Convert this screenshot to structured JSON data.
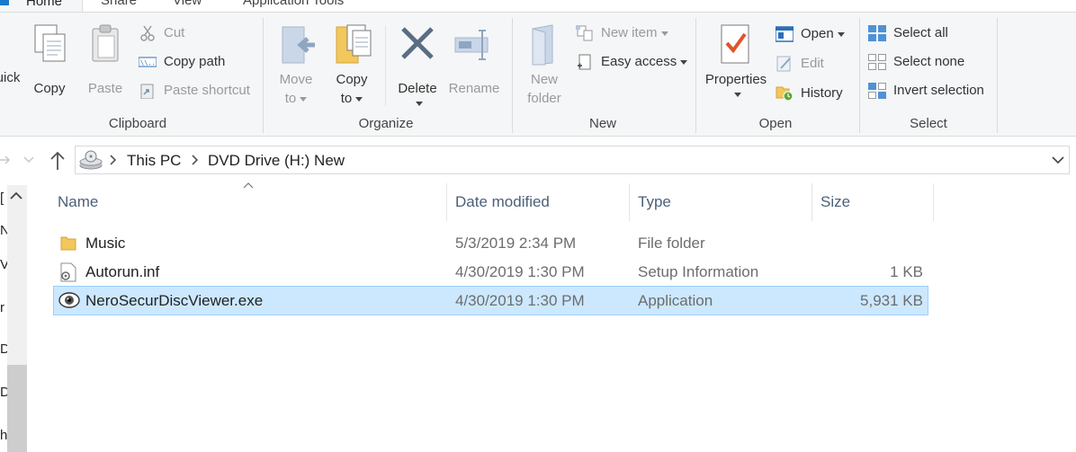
{
  "tabs": {
    "home": "Home",
    "share": "Share",
    "view": "View",
    "apptools": "Application Tools"
  },
  "clipboard": {
    "quick_access_label": "uick",
    "copy": "Copy",
    "paste": "Paste",
    "cut": "Cut",
    "copy_path": "Copy path",
    "paste_shortcut": "Paste shortcut",
    "group": "Clipboard"
  },
  "organize": {
    "move_to_1": "Move",
    "move_to_2": "to",
    "copy_to_1": "Copy",
    "copy_to_2": "to",
    "delete": "Delete",
    "rename": "Rename",
    "group": "Organize"
  },
  "new": {
    "new_folder_1": "New",
    "new_folder_2": "folder",
    "new_item": "New item",
    "easy_access": "Easy access",
    "group": "New"
  },
  "open": {
    "properties": "Properties",
    "open": "Open",
    "edit": "Edit",
    "history": "History",
    "group": "Open"
  },
  "select": {
    "select_all": "Select all",
    "select_none": "Select none",
    "invert": "Invert selection",
    "group": "Select"
  },
  "address": {
    "crumb1": "This PC",
    "crumb2": "DVD Drive (H:) New"
  },
  "left_chars": [
    "[",
    "N",
    "V",
    "r",
    "Dr",
    "Dr",
    "h"
  ],
  "columns": {
    "name": "Name",
    "date": "Date modified",
    "type": "Type",
    "size": "Size"
  },
  "files": [
    {
      "name": "Music",
      "date": "5/3/2019 2:34 PM",
      "type": "File folder",
      "size": "",
      "icon": "folder-icon"
    },
    {
      "name": "Autorun.inf",
      "date": "4/30/2019 1:30 PM",
      "type": "Setup Information",
      "size": "1 KB",
      "icon": "settings-file-icon"
    },
    {
      "name": "NeroSecurDiscViewer.exe",
      "date": "4/30/2019 1:30 PM",
      "type": "Application",
      "size": "5,931 KB",
      "icon": "eye-app-icon",
      "selected": true
    }
  ],
  "colors": {
    "accent": "#1979ca",
    "selection": "#cce8ff",
    "selection_border": "#99d1ff",
    "ribbon_bg": "#f5f6f7",
    "header_text": "#4c607a"
  }
}
